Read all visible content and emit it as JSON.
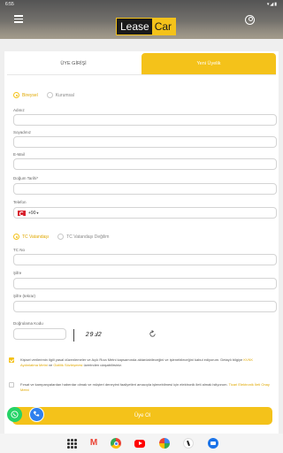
{
  "status_bar": {
    "time": "6:55",
    "system": "▾◢▮"
  },
  "header": {
    "logo_left": "Lease",
    "logo_right": "Car"
  },
  "tabs": {
    "login": "ÜYE GİRİŞİ",
    "register": "Yeni Üyelik"
  },
  "member_type": {
    "individual": "Bireysel",
    "corporate": "Kurumsal",
    "selected": "Bireysel"
  },
  "fields": {
    "name": "Adınız",
    "surname": "Soyadınız",
    "email": "E-Mail",
    "birth_date": "Doğum Tarihi*",
    "phone": "Telefon",
    "phone_code": "+90",
    "tc_no": "TC No",
    "password": "Şifre",
    "password_repeat": "Şifre (tekrar)",
    "verification_code": "Doğrulama Kodu"
  },
  "citizenship": {
    "citizen": "TC Vatandaşı",
    "non_citizen": "TC Vatandaşı Değilim",
    "selected": "TC Vatandaşı"
  },
  "captcha": {
    "text": "29Ⅎ2"
  },
  "consent1": {
    "text": "Kişisel verilerimin ilgili yasal düzenlemeler ve Açık Rıza Metni kapsamında aktarılabileceğini ve işlenebileceğini kabul ediyorum. Detaylı bilgiye",
    "link1": "KVKK Aydınlatma Metni",
    "mid": "ve",
    "link2": "Gizlilik Sözleşmesi",
    "tail": "üzerinden ulaşabilirsiniz.",
    "checked": true
  },
  "consent2": {
    "text": "Fırsat ve kampanyalardan haberdar olmak ve müşteri deneyimi faaliyetleri amacıyla işlenebilmesi için elektronik ileti almak istiyorum.",
    "link": "Ticari Elektronik İleti Onay Metni",
    "checked": false
  },
  "submit": {
    "label": "Üye Ol"
  },
  "colors": {
    "accent": "#f4c21a",
    "whatsapp": "#25d366",
    "call": "#2f80ed"
  },
  "nav_icons": [
    "apps-grid-icon",
    "gmail-icon",
    "chrome-icon",
    "youtube-icon",
    "photos-icon",
    "app-icon",
    "messages-icon"
  ]
}
